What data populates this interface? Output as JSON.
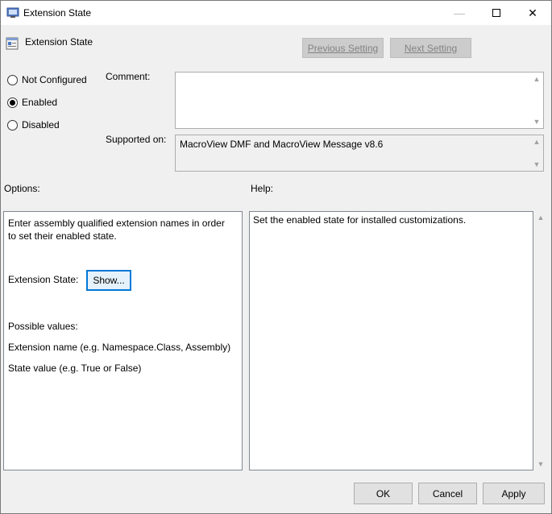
{
  "window": {
    "title": "Extension State",
    "controls": {
      "minimize": "—",
      "close": "✕"
    }
  },
  "header": {
    "title": "Extension State",
    "prev_button": "Previous Setting",
    "next_button": "Next Setting"
  },
  "state": {
    "options": [
      {
        "label": "Not Configured",
        "checked": false
      },
      {
        "label": "Enabled",
        "checked": true
      },
      {
        "label": "Disabled",
        "checked": false
      }
    ]
  },
  "comment": {
    "label": "Comment:",
    "value": ""
  },
  "supported": {
    "label": "Supported on:",
    "value": "MacroView DMF and MacroView Message v8.6"
  },
  "options_panel": {
    "label": "Options:",
    "description_line1": "Enter assembly qualified extension names in order",
    "description_line2": "to set their enabled state.",
    "extension_state_label": "Extension State:",
    "show_button": "Show...",
    "possible_values": "Possible values:",
    "extension_name_hint": "Extension name (e.g. Namespace.Class, Assembly)",
    "state_value_hint": "State value (e.g. True or False)"
  },
  "help_panel": {
    "label": "Help:",
    "text": "Set the enabled state for installed customizations."
  },
  "footer": {
    "ok": "OK",
    "cancel": "Cancel",
    "apply": "Apply"
  }
}
